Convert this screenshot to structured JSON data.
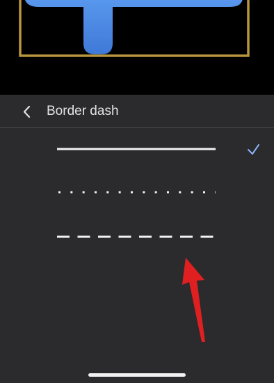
{
  "panel": {
    "title": "Border dash",
    "back_icon": "chevron-left-icon",
    "options": [
      {
        "style": "solid",
        "selected": true,
        "check_icon": "checkmark-icon"
      },
      {
        "style": "dotted",
        "selected": false
      },
      {
        "style": "dashed",
        "selected": false
      }
    ]
  },
  "colors": {
    "panel_background": "#2b2b2e",
    "line_color": "#f2f2f2",
    "check_color": "#8ab4f8",
    "frame_gold": "#b8963e",
    "shape_blue": "#4a86e0",
    "arrow_red": "#e02020"
  }
}
